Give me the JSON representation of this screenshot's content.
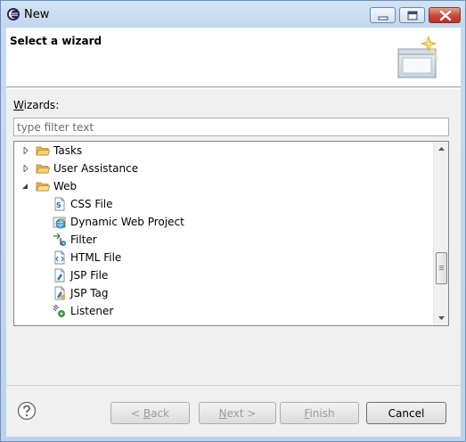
{
  "window": {
    "title": "New"
  },
  "banner": {
    "title": "Select a wizard"
  },
  "wizards_label_prefix": "W",
  "wizards_label_rest": "izards:",
  "filter": {
    "placeholder": "type filter text",
    "value": ""
  },
  "tree": {
    "items": [
      {
        "label": "Tasks",
        "type": "folder",
        "expanded": false,
        "level": 0
      },
      {
        "label": "User Assistance",
        "type": "folder",
        "expanded": false,
        "level": 0
      },
      {
        "label": "Web",
        "type": "folder",
        "expanded": true,
        "level": 0
      },
      {
        "label": "CSS File",
        "type": "css-file-icon",
        "level": 1
      },
      {
        "label": "Dynamic Web Project",
        "type": "web-project-icon",
        "level": 1
      },
      {
        "label": "Filter",
        "type": "filter-icon",
        "level": 1
      },
      {
        "label": "HTML File",
        "type": "html-file-icon",
        "level": 1
      },
      {
        "label": "JSP File",
        "type": "jsp-file-icon",
        "level": 1
      },
      {
        "label": "JSP Tag",
        "type": "jsp-tag-icon",
        "level": 1
      },
      {
        "label": "Listener",
        "type": "listener-icon",
        "level": 1
      }
    ]
  },
  "buttons": {
    "back_prefix": "< ",
    "back_mnemonic": "B",
    "back_rest": "ack",
    "next_prefix": "",
    "next_mnemonic": "N",
    "next_rest": "ext >",
    "finish_mnemonic": "F",
    "finish_rest": "inish",
    "cancel": "Cancel"
  },
  "colors": {
    "folder": "#e8b548",
    "accent": "#3c7fb1",
    "close": "#c8463a"
  }
}
